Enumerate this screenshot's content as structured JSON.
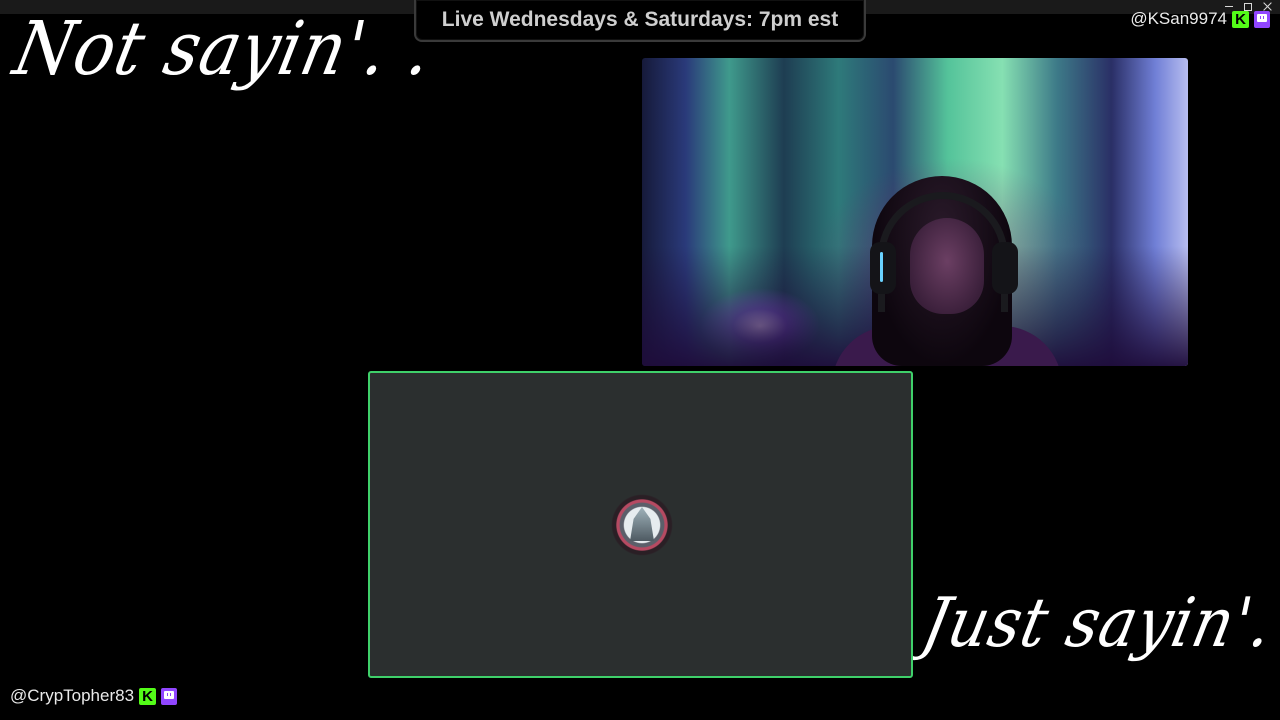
{
  "banner": {
    "text": "Live Wednesdays & Saturdays: 7pm est"
  },
  "overlay_text": {
    "top_left": "Not sayin'. .",
    "bottom_right": "Just sayin'. ."
  },
  "handles": {
    "top_right": "@KSan9974",
    "bottom_left": "@CrypTopher83"
  },
  "icons": {
    "kick": "kick-logo-icon",
    "twitch": "twitch-logo-icon",
    "kick_glyph": "K"
  },
  "colors": {
    "kick": "#53fc18",
    "twitch": "#9146ff",
    "speaker_border": "#3fd06a",
    "panel_bg": "#2b2f2f",
    "banner_text": "#cfcfcf"
  }
}
